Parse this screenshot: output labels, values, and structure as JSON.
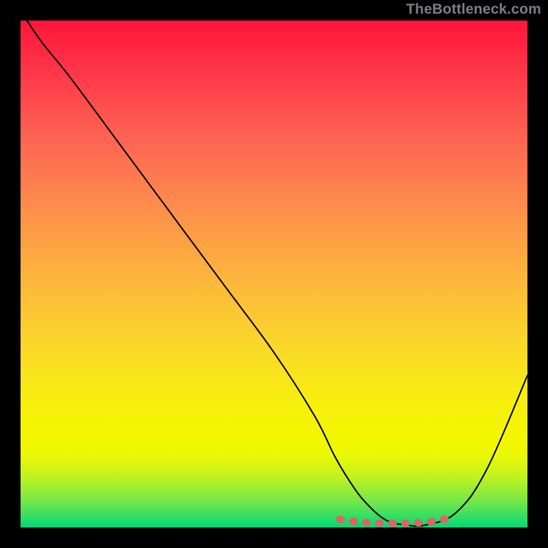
{
  "attribution": "TheBottleneck.com",
  "chart_data": {
    "type": "line",
    "title": "",
    "xlabel": "",
    "ylabel": "",
    "xlim": [
      0,
      100
    ],
    "ylim": [
      0,
      100
    ],
    "gradient_colors": {
      "top": "#fe163b",
      "mid": "#fad72a",
      "bottom": "#00d978"
    },
    "series": [
      {
        "name": "bottleneck-curve",
        "color": "#000000",
        "x": [
          0,
          4,
          10,
          20,
          30,
          40,
          50,
          58,
          62,
          65,
          68,
          72,
          76,
          80,
          86,
          92,
          100
        ],
        "y": [
          102,
          96,
          88.5,
          75,
          61.5,
          48,
          34.5,
          22,
          14,
          9,
          5,
          1.5,
          0.5,
          0.5,
          3,
          11.5,
          30
        ]
      },
      {
        "name": "optimal-region",
        "color": "#d86765",
        "style": "thick-dotted",
        "x": [
          63,
          64.5,
          66.5,
          69,
          72,
          75,
          77.5,
          80,
          82,
          84
        ],
        "y": [
          1.6,
          1.3,
          1.1,
          0.9,
          0.8,
          0.8,
          0.9,
          1.0,
          1.3,
          1.7
        ]
      }
    ]
  }
}
